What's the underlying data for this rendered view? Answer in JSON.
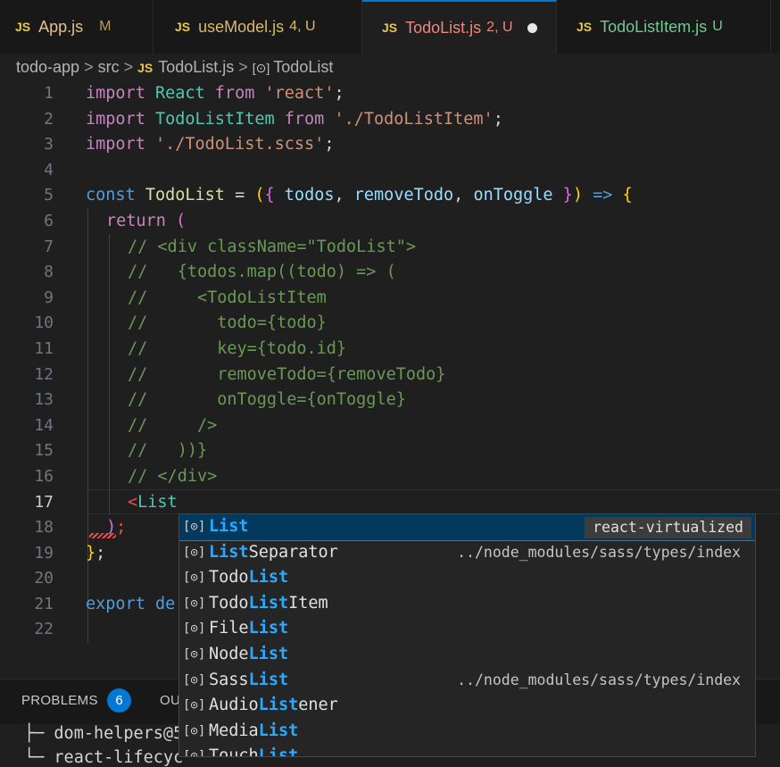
{
  "tabs": [
    {
      "label": "App.js",
      "status": "M",
      "color": "#e2c08d",
      "status_color": "#b89a5e"
    },
    {
      "label": "useModel.js",
      "status": "4, U",
      "color": "#d7b96a",
      "status_color": "#d7b96a"
    },
    {
      "label": "TodoList.js",
      "status": "2, U",
      "color": "#f0877d",
      "status_color": "#f0877d",
      "active": true
    },
    {
      "label": "TodoListItem.js",
      "status": "U",
      "color": "#73c991",
      "status_color": "#73c991"
    }
  ],
  "tab_file_type": "JS",
  "breadcrumbs": {
    "folder": "todo-app",
    "sub": "src",
    "file": "TodoList.js",
    "symbol": "TodoList"
  },
  "line_numbers": [
    "1",
    "2",
    "3",
    "4",
    "5",
    "6",
    "7",
    "8",
    "9",
    "10",
    "11",
    "12",
    "13",
    "14",
    "15",
    "16",
    "17",
    "18",
    "19",
    "20",
    "21",
    "22"
  ],
  "code": {
    "l1": [
      "import",
      " React ",
      "from",
      " 'react'",
      ";"
    ],
    "l2": [
      "import",
      " TodoListItem ",
      "from",
      " './TodoListItem'",
      ";"
    ],
    "l3": [
      "import",
      " './TodoList.scss'",
      ";"
    ],
    "l5": [
      "const",
      " TodoList",
      " = ",
      "(",
      "{",
      " todos",
      ", ",
      "removeTodo",
      ", ",
      "onToggle",
      " }",
      ")",
      " => ",
      "{"
    ],
    "l6": [
      "return",
      " ("
    ],
    "l7": "// <div className=\"TodoList\">",
    "l8": "//   {todos.map((todo) => (",
    "l9": "//     <TodoListItem",
    "l10": "//       todo={todo}",
    "l11": "//       key={todo.id}",
    "l12": "//       removeTodo={removeTodo}",
    "l13": "//       onToggle={onToggle}",
    "l14": "//     />",
    "l15": "//   ))}",
    "l16": "// </div>",
    "l17": [
      "<",
      "List"
    ],
    "l18": [
      ")",
      ";"
    ],
    "l19": [
      "}",
      ";"
    ],
    "l21": [
      "export",
      " de"
    ]
  },
  "suggestions": [
    {
      "match": "List",
      "rest": "",
      "detail": "react-virtualized",
      "selected": true
    },
    {
      "match": "List",
      "rest": "Separator",
      "detail": "../node_modules/sass/types/index"
    },
    {
      "pre": "Todo",
      "match": "List",
      "rest": "",
      "detail": ""
    },
    {
      "pre": "Todo",
      "match": "List",
      "rest": "Item",
      "detail": ""
    },
    {
      "pre": "File",
      "match": "List",
      "rest": "",
      "detail": ""
    },
    {
      "pre": "Node",
      "match": "List",
      "rest": "",
      "detail": ""
    },
    {
      "pre": "Sass",
      "match": "List",
      "rest": "",
      "detail": "../node_modules/sass/types/index"
    },
    {
      "pre": "Audio",
      "match": "List",
      "rest": "ener",
      "detail": ""
    },
    {
      "pre": "Media",
      "match": "List",
      "rest": "",
      "detail": ""
    },
    {
      "pre": "Touch",
      "match": "List",
      "rest": "",
      "detail": ""
    }
  ],
  "panel": {
    "problems_label": "PROBLEMS",
    "problems_count": "6",
    "output_label": "OU"
  },
  "terminal": [
    "├─ dom-helpers@5",
    "└─ react-lifecyc"
  ]
}
